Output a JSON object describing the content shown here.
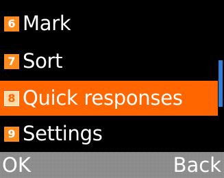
{
  "menu": {
    "items": [
      {
        "number": "6",
        "label": "Mark",
        "selected": false
      },
      {
        "number": "7",
        "label": "Sort",
        "selected": false
      },
      {
        "number": "8",
        "label": "Quick responses",
        "selected": true
      },
      {
        "number": "9",
        "label": "Settings",
        "selected": false
      }
    ]
  },
  "softkeys": {
    "left": "OK",
    "right": "Back"
  },
  "colors": {
    "background": "#000000",
    "selection": "#ff6600",
    "badge": "#ff8a1e",
    "scrollbar": "#2f7fd8",
    "softkey_bar": "#8c8c8c"
  }
}
